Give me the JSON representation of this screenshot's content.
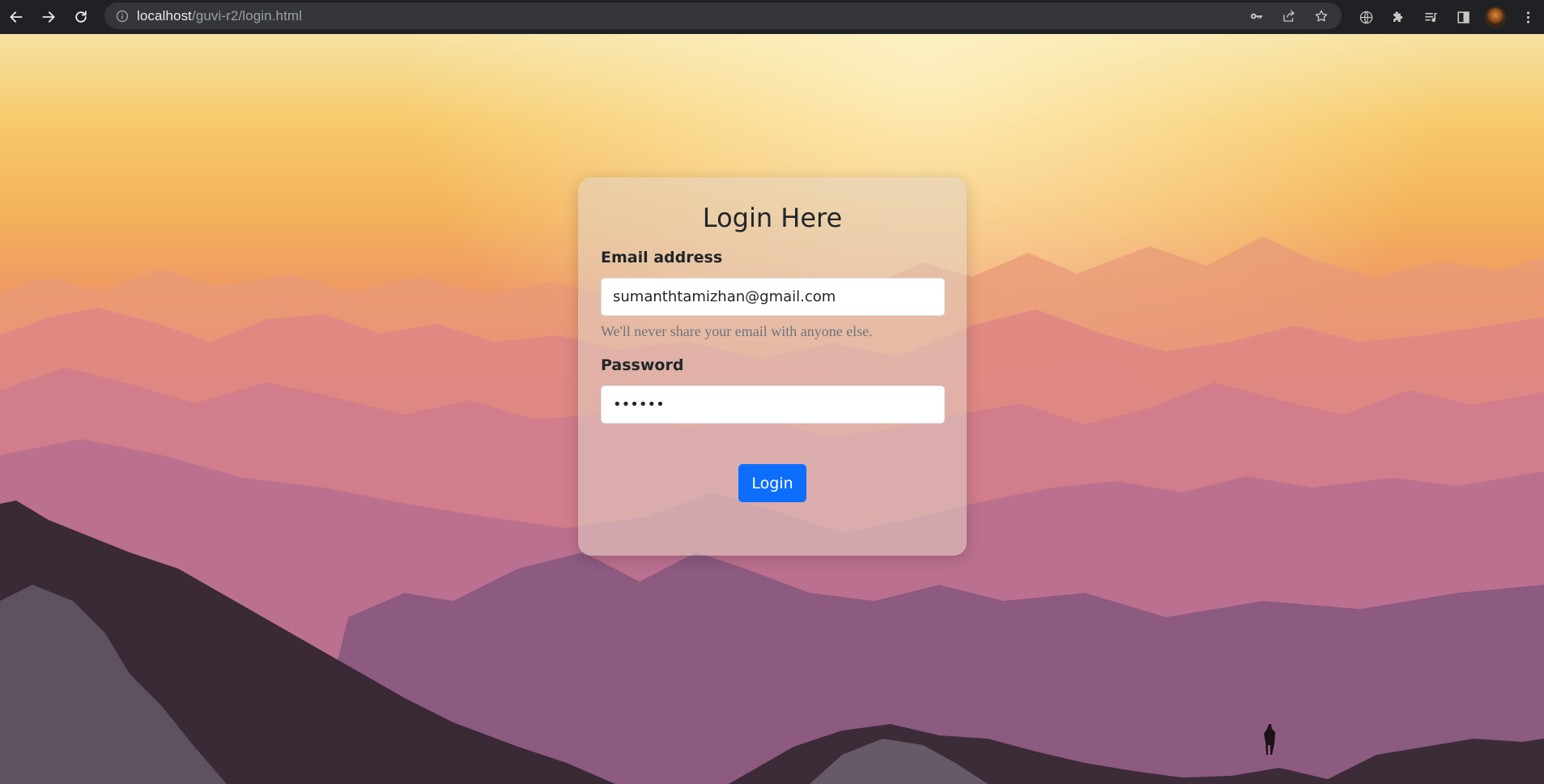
{
  "browser": {
    "url_host": "localhost",
    "url_path": "/guvi-r2/login.html"
  },
  "login": {
    "title": "Login Here",
    "email_label": "Email address",
    "email_value": "sumanthtamizhan@gmail.com",
    "email_help": "We'll never share your email with anyone else.",
    "password_label": "Password",
    "password_value": "abc123",
    "button_label": "Login"
  },
  "colors": {
    "button": "#0d6efd",
    "browser_chrome": "#202124"
  }
}
